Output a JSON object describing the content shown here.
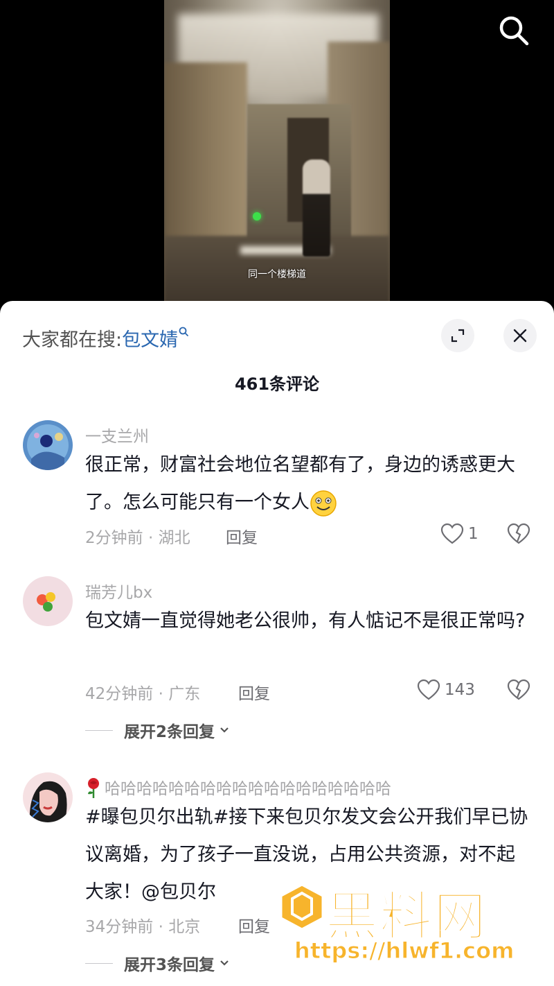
{
  "video": {
    "caption": "同一个楼梯道"
  },
  "search_bar": {
    "prefix": "大家都在搜:",
    "keyword": "包文婧"
  },
  "comments_header": {
    "count_label": "461条评论"
  },
  "comments": [
    {
      "username": "一支兰州",
      "text": "很正常，财富社会地位名望都有了，身边的诱惑更大了。怎么可能只有一个女人",
      "meta": "2分钟前 · 湖北",
      "reply_label": "回复",
      "likes": "1"
    },
    {
      "username": "瑞芳儿bx",
      "text": "包文婧一直觉得她老公很帅，有人惦记不是很正常吗?",
      "meta": "42分钟前 · 广东",
      "reply_label": "回复",
      "likes": "143",
      "expand_label": "展开2条回复"
    },
    {
      "username": "哈哈哈哈哈哈哈哈哈哈哈哈哈哈哈哈哈哈",
      "text": "#曝包贝尔出轨#接下来包贝尔发文会公开我们早已协议离婚，为了孩子一直没说，占用公共资源，对不起大家！@包贝尔",
      "meta": "34分钟前 · 北京",
      "reply_label": "回复",
      "expand_label": "展开3条回复"
    }
  ],
  "watermark": {
    "title": "黑料网",
    "url": "https://hlwf1.com"
  },
  "colors": {
    "keyword_blue": "#2a67b0",
    "watermark_orange": "#f7b42c",
    "muted_text": "#a7a7a9"
  }
}
